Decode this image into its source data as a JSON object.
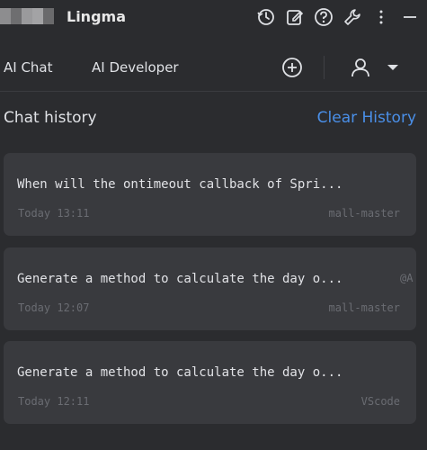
{
  "app": {
    "title": "Lingma",
    "brand_colors": [
      "#8d8d8f",
      "#6e6e70",
      "#9a9a9c",
      "#a3a3a5",
      "#6a6a6c"
    ]
  },
  "toolbar": {
    "icons": [
      "history-icon",
      "edit-icon",
      "help-icon",
      "settings-wrench-icon",
      "more-vertical-icon",
      "minimize-icon"
    ]
  },
  "tabs": [
    {
      "label": "AI Chat"
    },
    {
      "label": "AI Developer"
    }
  ],
  "tab_actions": {
    "icons": [
      "new-chat-plus-icon",
      "user-icon",
      "dropdown-caret-icon"
    ]
  },
  "history": {
    "title": "Chat history",
    "clear_label": "Clear History",
    "items": [
      {
        "question": "When will the ontimeout callback of Spri...",
        "tag": "",
        "time": "Today 13:11",
        "project": "mall-master"
      },
      {
        "question": "Generate a method to calculate the day o...",
        "tag": "@A",
        "time": "Today 12:07",
        "project": "mall-master"
      },
      {
        "question": "Generate a method to calculate the day o...",
        "tag": "",
        "time": "Today 12:11",
        "project": "VScode"
      }
    ]
  },
  "colors": {
    "background": "#2b2c2f",
    "card": "#393a3e",
    "accent_link": "#4a8fe8",
    "muted_text": "#6a6c72"
  }
}
